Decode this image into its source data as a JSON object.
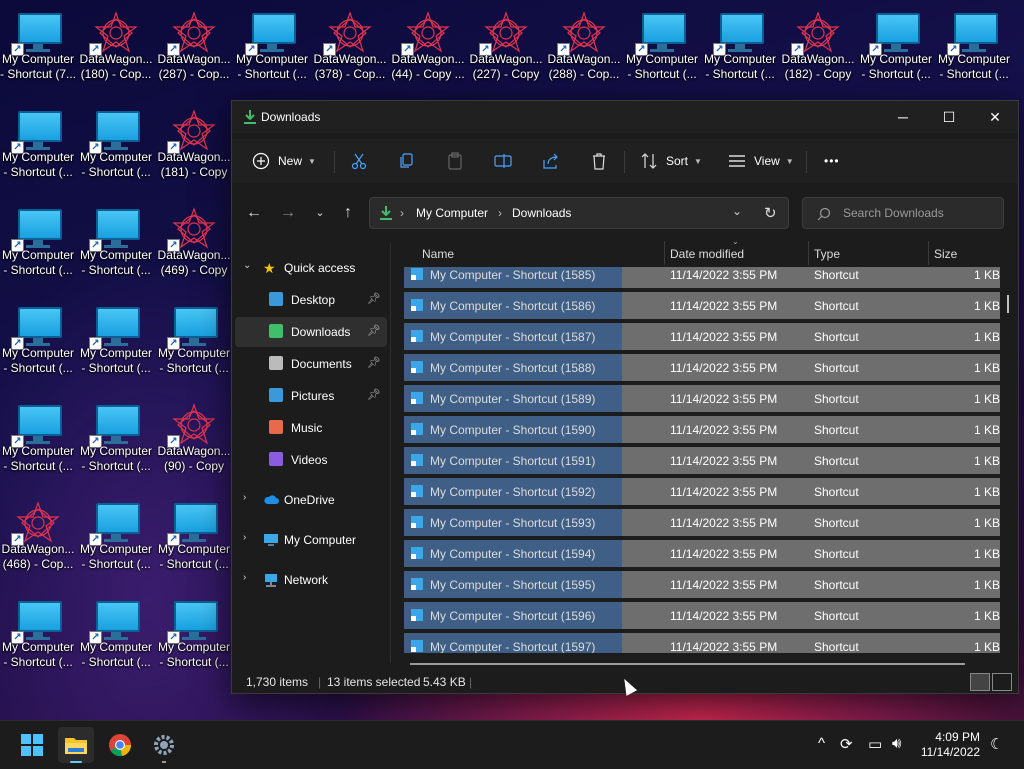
{
  "desktop": {
    "icons": [
      {
        "type": "computer",
        "label1": "My Computer",
        "label2": "- Shortcut (7..."
      },
      {
        "type": "star",
        "label1": "DataWagon...",
        "label2": "(180) - Cop..."
      },
      {
        "type": "star",
        "label1": "DataWagon...",
        "label2": "(287) - Cop..."
      },
      {
        "type": "computer",
        "label1": "My Computer",
        "label2": "- Shortcut (..."
      },
      {
        "type": "star",
        "label1": "DataWagon...",
        "label2": "(378) - Cop..."
      },
      {
        "type": "star",
        "label1": "DataWagon...",
        "label2": "(44) - Copy ..."
      },
      {
        "type": "star",
        "label1": "DataWagon...",
        "label2": "(227) - Copy"
      },
      {
        "type": "star",
        "label1": "DataWagon...",
        "label2": "(288) - Cop..."
      },
      {
        "type": "computer",
        "label1": "My Computer",
        "label2": "- Shortcut (..."
      },
      {
        "type": "computer",
        "label1": "My Computer",
        "label2": "- Shortcut (..."
      },
      {
        "type": "star",
        "label1": "DataWagon...",
        "label2": "(182) - Copy"
      },
      {
        "type": "computer",
        "label1": "My Computer",
        "label2": "- Shortcut (..."
      },
      {
        "type": "computer",
        "label1": "My Computer",
        "label2": "- Shortcut (..."
      },
      {
        "type": "computer",
        "label1": "My Computer",
        "label2": "- Shortcut (..."
      },
      {
        "type": "computer",
        "label1": "My Computer",
        "label2": "- Shortcut (..."
      },
      {
        "type": "star",
        "label1": "DataWagon...",
        "label2": "(181) - Copy"
      },
      {
        "type": "computer",
        "label1": "My Computer",
        "label2": "- Shortcut (..."
      },
      {
        "type": "computer",
        "label1": "My Computer",
        "label2": "- Shortcut (..."
      },
      {
        "type": "star",
        "label1": "DataWagon...",
        "label2": "(469) - Copy"
      },
      {
        "type": "computer",
        "label1": "My Computer",
        "label2": "- Shortcut (..."
      },
      {
        "type": "computer",
        "label1": "My Computer",
        "label2": "- Shortcut (..."
      },
      {
        "type": "computer",
        "label1": "My Computer",
        "label2": "- Shortcut (..."
      },
      {
        "type": "computer",
        "label1": "My Computer",
        "label2": "- Shortcut (..."
      },
      {
        "type": "computer",
        "label1": "My Computer",
        "label2": "- Shortcut (..."
      },
      {
        "type": "star",
        "label1": "DataWagon...",
        "label2": "(90) - Copy"
      },
      {
        "type": "star",
        "label1": "DataWagon...",
        "label2": "(468) - Cop..."
      },
      {
        "type": "computer",
        "label1": "My Computer",
        "label2": "- Shortcut (..."
      },
      {
        "type": "computer",
        "label1": "My Computer",
        "label2": "- Shortcut (..."
      },
      {
        "type": "computer",
        "label1": "My Computer",
        "label2": "- Shortcut (..."
      },
      {
        "type": "computer",
        "label1": "My Computer",
        "label2": "- Shortcut (..."
      },
      {
        "type": "computer",
        "label1": "My Computer",
        "label2": "- Shortcut (..."
      }
    ]
  },
  "window": {
    "title": "Downloads",
    "controls": {
      "minimize": "─",
      "maximize": "☐",
      "close": "✕"
    },
    "toolbar": {
      "new_label": "New",
      "sort_label": "Sort",
      "view_label": "View",
      "more_label": "•••"
    },
    "address": {
      "root": "My Computer",
      "current": "Downloads",
      "separator": "›"
    },
    "search": {
      "placeholder": "Search Downloads"
    },
    "sidebar": {
      "quick_access": "Quick access",
      "pinned": [
        {
          "label": "Desktop",
          "icon": "desktop-icon",
          "color": "#3a9ad9"
        },
        {
          "label": "Downloads",
          "icon": "downloads-icon",
          "color": "#3fbf6a"
        },
        {
          "label": "Documents",
          "icon": "documents-icon",
          "color": "#bbbbbb"
        },
        {
          "label": "Pictures",
          "icon": "pictures-icon",
          "color": "#3a9ad9"
        },
        {
          "label": "Music",
          "icon": "music-icon",
          "color": "#e86a4a"
        },
        {
          "label": "Videos",
          "icon": "videos-icon",
          "color": "#8a5ce0"
        }
      ],
      "onedrive": "OneDrive",
      "this_pc": "My Computer",
      "network": "Network"
    },
    "columns": {
      "name": "Name",
      "date": "Date modified",
      "type": "Type",
      "size": "Size"
    },
    "files": [
      {
        "name": "My Computer - Shortcut (1585)",
        "date": "11/14/2022 3:55 PM",
        "type": "Shortcut",
        "size": "1 KB"
      },
      {
        "name": "My Computer - Shortcut (1586)",
        "date": "11/14/2022 3:55 PM",
        "type": "Shortcut",
        "size": "1 KB"
      },
      {
        "name": "My Computer - Shortcut (1587)",
        "date": "11/14/2022 3:55 PM",
        "type": "Shortcut",
        "size": "1 KB"
      },
      {
        "name": "My Computer - Shortcut (1588)",
        "date": "11/14/2022 3:55 PM",
        "type": "Shortcut",
        "size": "1 KB"
      },
      {
        "name": "My Computer - Shortcut (1589)",
        "date": "11/14/2022 3:55 PM",
        "type": "Shortcut",
        "size": "1 KB"
      },
      {
        "name": "My Computer - Shortcut (1590)",
        "date": "11/14/2022 3:55 PM",
        "type": "Shortcut",
        "size": "1 KB"
      },
      {
        "name": "My Computer - Shortcut (1591)",
        "date": "11/14/2022 3:55 PM",
        "type": "Shortcut",
        "size": "1 KB"
      },
      {
        "name": "My Computer - Shortcut (1592)",
        "date": "11/14/2022 3:55 PM",
        "type": "Shortcut",
        "size": "1 KB"
      },
      {
        "name": "My Computer - Shortcut (1593)",
        "date": "11/14/2022 3:55 PM",
        "type": "Shortcut",
        "size": "1 KB"
      },
      {
        "name": "My Computer - Shortcut (1594)",
        "date": "11/14/2022 3:55 PM",
        "type": "Shortcut",
        "size": "1 KB"
      },
      {
        "name": "My Computer - Shortcut (1595)",
        "date": "11/14/2022 3:55 PM",
        "type": "Shortcut",
        "size": "1 KB"
      },
      {
        "name": "My Computer - Shortcut (1596)",
        "date": "11/14/2022 3:55 PM",
        "type": "Shortcut",
        "size": "1 KB"
      },
      {
        "name": "My Computer - Shortcut (1597)",
        "date": "11/14/2022 3:55 PM",
        "type": "Shortcut",
        "size": "1 KB"
      }
    ],
    "status": {
      "count": "1,730 items",
      "selected": "13 items selected",
      "size": "5.43 KB"
    }
  },
  "taskbar": {
    "apps": [
      "start-icon",
      "file-explorer-icon",
      "chrome-icon",
      "settings-icon"
    ],
    "time": "4:09 PM",
    "date": "11/14/2022"
  },
  "colors": {
    "accent": "#60cdff",
    "selection": "#3f5f86",
    "row": "#6e6e6e",
    "downloads": "#3fbf6a"
  }
}
